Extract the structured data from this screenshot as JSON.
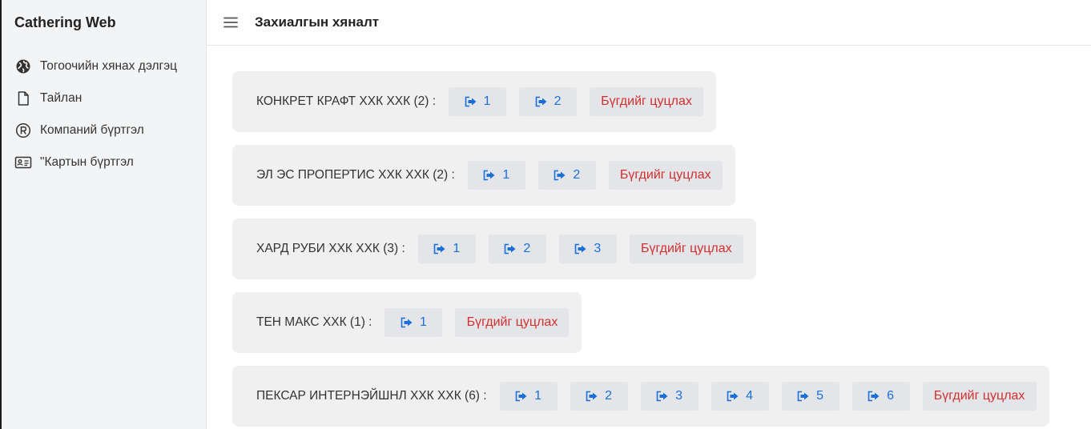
{
  "app": {
    "title": "Cathering Web"
  },
  "sidebar": {
    "items": [
      {
        "label": "Тогоочийн хянах дэлгэц",
        "icon": "globe-icon"
      },
      {
        "label": "Тайлан",
        "icon": "file-icon"
      },
      {
        "label": "Компаний бүртгэл",
        "icon": "registered-icon"
      },
      {
        "label": "\"Картын бүртгэл",
        "icon": "id-card-icon"
      }
    ]
  },
  "header": {
    "title": "Захиалгын хяналт",
    "menu_icon": "hamburger-icon"
  },
  "colors": {
    "accent": "#1a6fdb",
    "danger": "#d32f2f",
    "card_bg": "#f0f0f0",
    "button_bg": "#e3e5e8"
  },
  "orders": [
    {
      "company": "КОНКРЕТ КРАФТ ХХК ХХК (2) :",
      "buttons": [
        "1",
        "2"
      ],
      "cancel_label": "Бүгдийг цуцлах"
    },
    {
      "company": "ЭЛ ЭС ПРОПЕРТИС ХХК ХХК (2) :",
      "buttons": [
        "1",
        "2"
      ],
      "cancel_label": "Бүгдийг цуцлах"
    },
    {
      "company": "ХАРД РУБИ ХХК ХХК (3) :",
      "buttons": [
        "1",
        "2",
        "3"
      ],
      "cancel_label": "Бүгдийг цуцлах"
    },
    {
      "company": "ТЕН МАКС ХХК (1) :",
      "buttons": [
        "1"
      ],
      "cancel_label": "Бүгдийг цуцлах"
    },
    {
      "company": "ПЕКСАР ИНТЕРНЭЙШНЛ ХХК ХХК (6) :",
      "buttons": [
        "1",
        "2",
        "3",
        "4",
        "5",
        "6"
      ],
      "cancel_label": "Бүгдийг цуцлах"
    }
  ]
}
